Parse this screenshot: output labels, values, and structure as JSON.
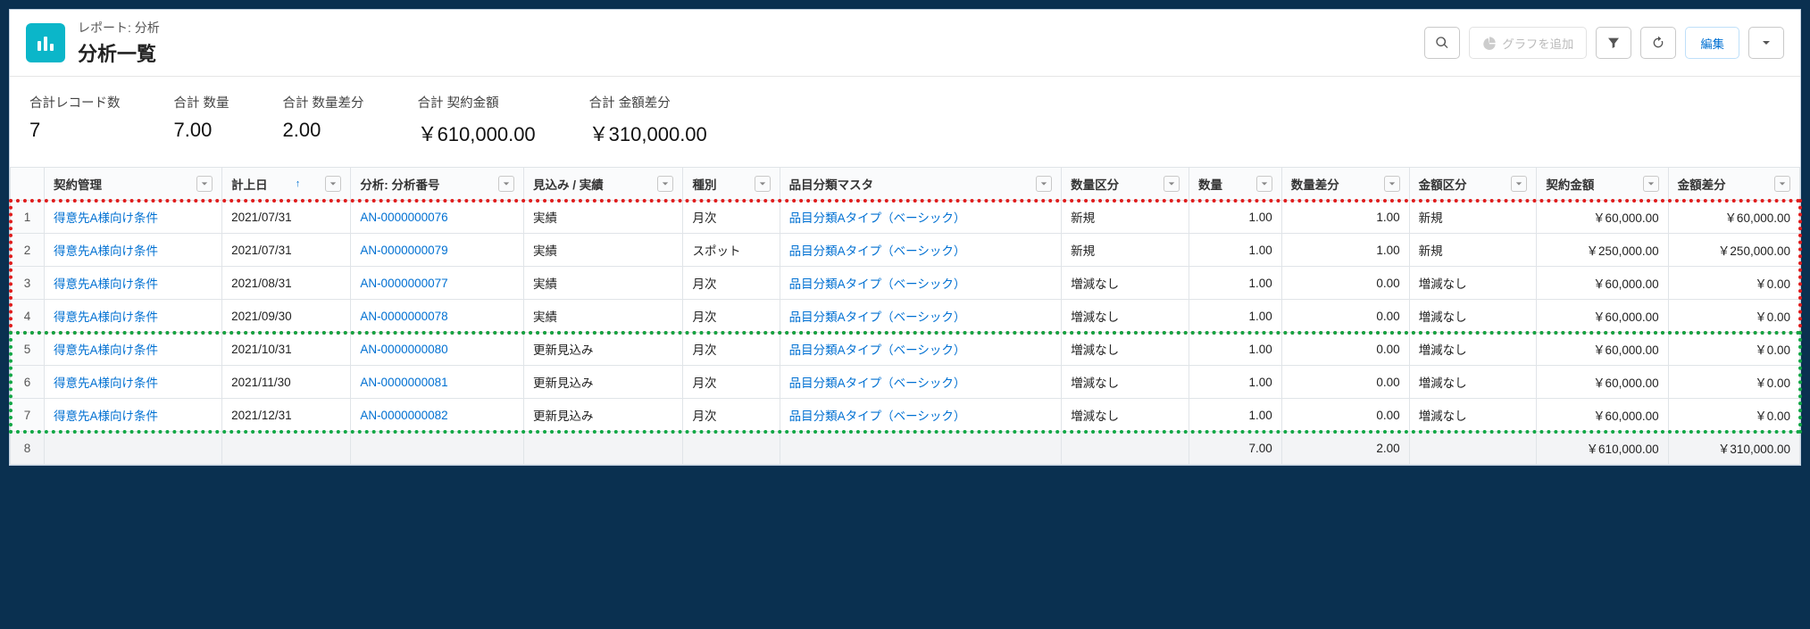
{
  "header": {
    "breadcrumb": "レポート: 分析",
    "title": "分析一覧",
    "add_chart_label": "グラフを追加",
    "edit_label": "編集"
  },
  "summary": [
    {
      "label": "合計レコード数",
      "value": "7"
    },
    {
      "label": "合計 数量",
      "value": "7.00"
    },
    {
      "label": "合計 数量差分",
      "value": "2.00"
    },
    {
      "label": "合計 契約金額",
      "value": "￥610,000.00"
    },
    {
      "label": "合計 金額差分",
      "value": "￥310,000.00"
    }
  ],
  "columns": {
    "contract": "契約管理",
    "date": "計上日",
    "analysis_no": "分析: 分析番号",
    "forecast": "見込み / 実績",
    "kind": "種別",
    "item_master": "品目分類マスタ",
    "qty_class": "数量区分",
    "qty": "数量",
    "qty_diff": "数量差分",
    "amt_class": "金額区分",
    "contract_amt": "契約金額",
    "amt_diff": "金額差分"
  },
  "rows": [
    {
      "n": "1",
      "contract": "得意先A様向け条件",
      "date": "2021/07/31",
      "an": "AN-0000000076",
      "fc": "実績",
      "kind": "月次",
      "item": "品目分類Aタイプ（ベーシック）",
      "qc": "新規",
      "qty": "1.00",
      "qd": "1.00",
      "ac": "新規",
      "amt": "￥60,000.00",
      "ad": "￥60,000.00"
    },
    {
      "n": "2",
      "contract": "得意先A様向け条件",
      "date": "2021/07/31",
      "an": "AN-0000000079",
      "fc": "実績",
      "kind": "スポット",
      "item": "品目分類Aタイプ（ベーシック）",
      "qc": "新規",
      "qty": "1.00",
      "qd": "1.00",
      "ac": "新規",
      "amt": "￥250,000.00",
      "ad": "￥250,000.00"
    },
    {
      "n": "3",
      "contract": "得意先A様向け条件",
      "date": "2021/08/31",
      "an": "AN-0000000077",
      "fc": "実績",
      "kind": "月次",
      "item": "品目分類Aタイプ（ベーシック）",
      "qc": "増減なし",
      "qty": "1.00",
      "qd": "0.00",
      "ac": "増減なし",
      "amt": "￥60,000.00",
      "ad": "￥0.00"
    },
    {
      "n": "4",
      "contract": "得意先A様向け条件",
      "date": "2021/09/30",
      "an": "AN-0000000078",
      "fc": "実績",
      "kind": "月次",
      "item": "品目分類Aタイプ（ベーシック）",
      "qc": "増減なし",
      "qty": "1.00",
      "qd": "0.00",
      "ac": "増減なし",
      "amt": "￥60,000.00",
      "ad": "￥0.00"
    },
    {
      "n": "5",
      "contract": "得意先A様向け条件",
      "date": "2021/10/31",
      "an": "AN-0000000080",
      "fc": "更新見込み",
      "kind": "月次",
      "item": "品目分類Aタイプ（ベーシック）",
      "qc": "増減なし",
      "qty": "1.00",
      "qd": "0.00",
      "ac": "増減なし",
      "amt": "￥60,000.00",
      "ad": "￥0.00"
    },
    {
      "n": "6",
      "contract": "得意先A様向け条件",
      "date": "2021/11/30",
      "an": "AN-0000000081",
      "fc": "更新見込み",
      "kind": "月次",
      "item": "品目分類Aタイプ（ベーシック）",
      "qc": "増減なし",
      "qty": "1.00",
      "qd": "0.00",
      "ac": "増減なし",
      "amt": "￥60,000.00",
      "ad": "￥0.00"
    },
    {
      "n": "7",
      "contract": "得意先A様向け条件",
      "date": "2021/12/31",
      "an": "AN-0000000082",
      "fc": "更新見込み",
      "kind": "月次",
      "item": "品目分類Aタイプ（ベーシック）",
      "qc": "増減なし",
      "qty": "1.00",
      "qd": "0.00",
      "ac": "増減なし",
      "amt": "￥60,000.00",
      "ad": "￥0.00"
    }
  ],
  "totals": {
    "n": "8",
    "qty": "7.00",
    "qd": "2.00",
    "amt": "￥610,000.00",
    "ad": "￥310,000.00"
  }
}
